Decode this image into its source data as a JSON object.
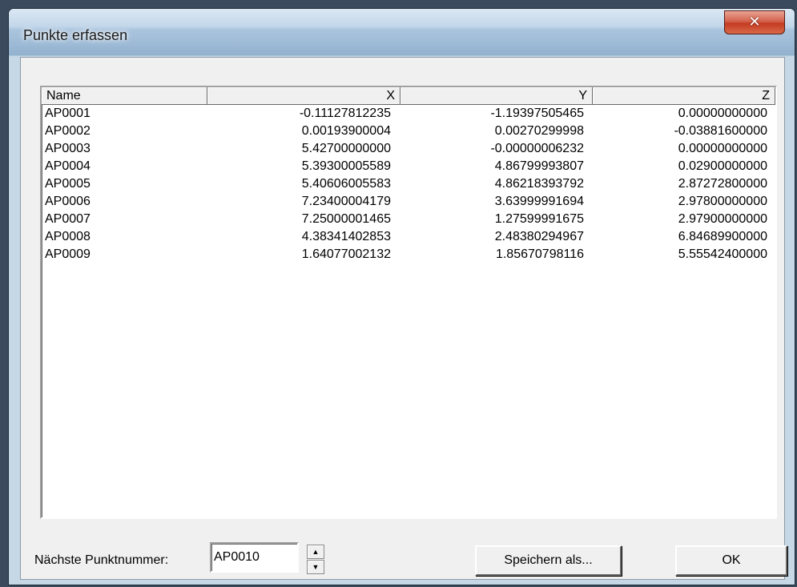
{
  "window": {
    "title": "Punkte erfassen",
    "close_glyph": "✕"
  },
  "list": {
    "columns": [
      "Name",
      "X",
      "Y",
      "Z"
    ],
    "rows": [
      [
        "AP0001",
        "-0.11127812235",
        "-1.19397505465",
        "0.00000000000"
      ],
      [
        "AP0002",
        "0.00193900004",
        "0.00270299998",
        "-0.03881600000"
      ],
      [
        "AP0003",
        "5.42700000000",
        "-0.00000006232",
        "0.00000000000"
      ],
      [
        "AP0004",
        "5.39300005589",
        "4.86799993807",
        "0.02900000000"
      ],
      [
        "AP0005",
        "5.40606005583",
        "4.86218393792",
        "2.87272800000"
      ],
      [
        "AP0006",
        "7.23400004179",
        "3.63999991694",
        "2.97800000000"
      ],
      [
        "AP0007",
        "7.25000001465",
        "1.27599991675",
        "2.97900000000"
      ],
      [
        "AP0008",
        "4.38341402853",
        "2.48380294967",
        "6.84689900000"
      ],
      [
        "AP0009",
        "1.64077002132",
        "1.85670798116",
        "5.55542400000"
      ]
    ]
  },
  "footer": {
    "next_label": "Nächste Punktnummer:",
    "next_value": "AP0010",
    "spin_up": "▲",
    "spin_down": "▼",
    "save_label": "Speichern als...",
    "ok_label": "OK"
  }
}
